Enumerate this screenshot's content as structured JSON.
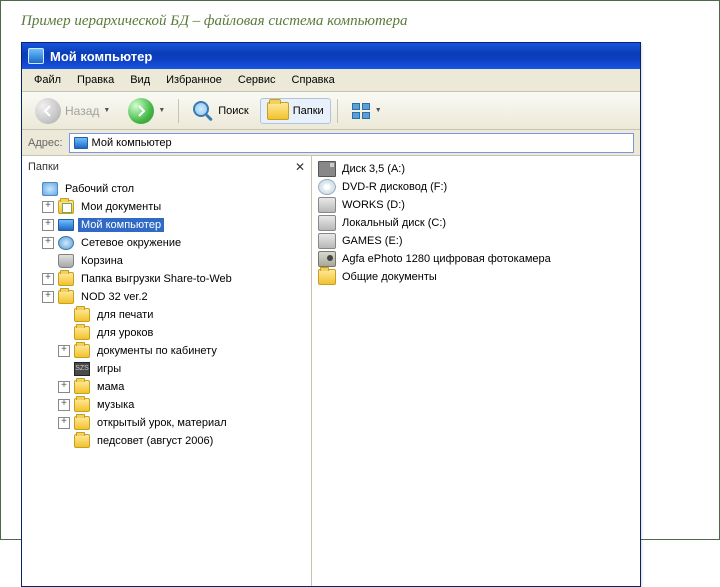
{
  "slide_title": "Пример иерархической БД – файловая система компьютера",
  "window": {
    "title": "Мой компьютер",
    "menu": [
      "Файл",
      "Правка",
      "Вид",
      "Избранное",
      "Сервис",
      "Справка"
    ],
    "toolbar": {
      "back_label": "Назад",
      "search_label": "Поиск",
      "folders_label": "Папки"
    },
    "address": {
      "label": "Адрес:",
      "value": "Мой компьютер"
    }
  },
  "folders_panel": {
    "title": "Папки"
  },
  "tree": [
    {
      "exp": "",
      "ind": 0,
      "icon": "desktop",
      "label": "Рабочий стол"
    },
    {
      "exp": "+",
      "ind": 1,
      "icon": "folder-doc",
      "label": "Мои документы"
    },
    {
      "exp": "+",
      "ind": 1,
      "icon": "computer",
      "label": "Мой компьютер",
      "selected": true
    },
    {
      "exp": "+",
      "ind": 1,
      "icon": "network",
      "label": "Сетевое окружение"
    },
    {
      "exp": "",
      "ind": 1,
      "icon": "trash",
      "label": "Корзина"
    },
    {
      "exp": "+",
      "ind": 1,
      "icon": "folder",
      "label": "Папка выгрузки Share-to-Web"
    },
    {
      "exp": "+",
      "ind": 1,
      "icon": "folder",
      "label": "NOD 32 ver.2"
    },
    {
      "exp": "",
      "ind": 2,
      "icon": "folder",
      "label": "для печати"
    },
    {
      "exp": "",
      "ind": 2,
      "icon": "folder",
      "label": "для уроков"
    },
    {
      "exp": "+",
      "ind": 2,
      "icon": "folder",
      "label": "документы по кабинету"
    },
    {
      "exp": "",
      "ind": 2,
      "icon": "special",
      "label": "игры"
    },
    {
      "exp": "+",
      "ind": 2,
      "icon": "folder",
      "label": "мама"
    },
    {
      "exp": "+",
      "ind": 2,
      "icon": "folder",
      "label": "музыка"
    },
    {
      "exp": "+",
      "ind": 2,
      "icon": "folder",
      "label": "открытый урок, материал"
    },
    {
      "exp": "",
      "ind": 2,
      "icon": "folder",
      "label": "педсовет (август 2006)"
    }
  ],
  "list": [
    {
      "icon": "floppy",
      "label": "Диск 3,5 (A:)"
    },
    {
      "icon": "dvd",
      "label": "DVD-R дисковод (F:)"
    },
    {
      "icon": "drive",
      "label": "WORKS (D:)"
    },
    {
      "icon": "drive",
      "label": "Локальный диск (C:)"
    },
    {
      "icon": "drive",
      "label": "GAMES (E:)"
    },
    {
      "icon": "camera",
      "label": "Agfa ePhoto 1280 цифровая фотокамера"
    },
    {
      "icon": "folder",
      "label": "Общие документы"
    }
  ]
}
